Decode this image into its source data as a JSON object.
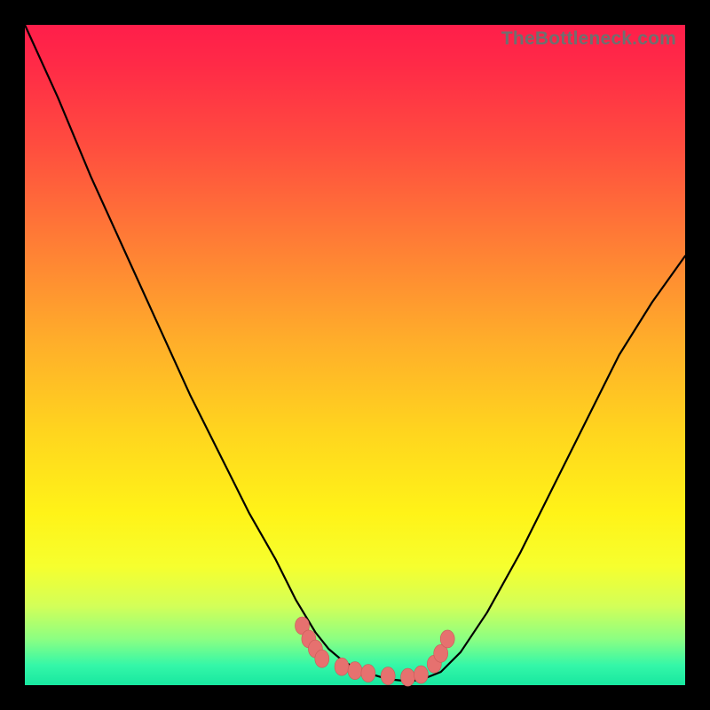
{
  "watermark": "TheBottleneck.com",
  "colors": {
    "frame": "#000000",
    "gradient_top": "#ff1e4a",
    "gradient_bottom": "#18e7a0",
    "curve": "#000000",
    "dots": "#e6716f"
  },
  "chart_data": {
    "type": "line",
    "title": "",
    "xlabel": "",
    "ylabel": "",
    "xlim": [
      0,
      100
    ],
    "ylim": [
      0,
      100
    ],
    "grid": false,
    "legend": false,
    "series": [
      {
        "name": "curve",
        "x": [
          0,
          5,
          10,
          15,
          20,
          25,
          30,
          34,
          38,
          41,
          44,
          46,
          48,
          50,
          52,
          54,
          56,
          58,
          60,
          63,
          66,
          70,
          75,
          80,
          85,
          90,
          95,
          100
        ],
        "values": [
          100,
          89,
          77,
          66,
          55,
          44,
          34,
          26,
          19,
          13,
          8,
          5.5,
          3.8,
          2.6,
          1.8,
          1.2,
          0.8,
          0.6,
          0.8,
          2,
          5,
          11,
          20,
          30,
          40,
          50,
          58,
          65
        ]
      }
    ],
    "highlight_dots": {
      "name": "valley-markers",
      "x": [
        42,
        43,
        44,
        45,
        48,
        50,
        52,
        55,
        58,
        60,
        62,
        63,
        64
      ],
      "values": [
        9,
        7,
        5.5,
        4,
        2.8,
        2.2,
        1.8,
        1.4,
        1.2,
        1.6,
        3.2,
        4.8,
        7
      ]
    }
  }
}
